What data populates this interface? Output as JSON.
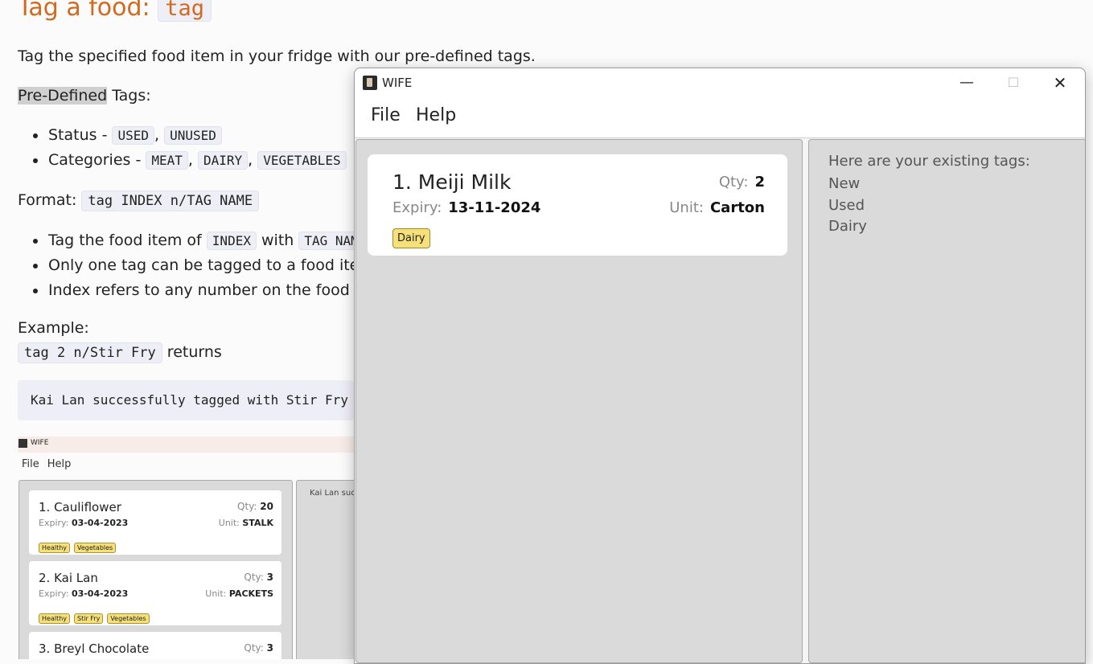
{
  "doc": {
    "title": "Tag a food: ",
    "title_code": "tag",
    "intro": "Tag the specified food item in your fridge with our pre-defined tags.",
    "predefined_highlight": "Pre-Defined",
    "predefined_rest": " Tags:",
    "status_label": "Status - ",
    "status_tags": [
      "USED",
      "UNUSED"
    ],
    "categories_label": "Categories - ",
    "category_tags": [
      "MEAT",
      "DAIRY",
      "VEGETABLES"
    ],
    "format_label": "Format: ",
    "format_code": "tag INDEX n/TAG NAME",
    "bullet1_pre": "Tag the food item of ",
    "bullet1_code1": "INDEX",
    "bullet1_mid": " with ",
    "bullet1_code2": "TAG NAME",
    "bullet2": "Only one tag can be tagged to a food item",
    "bullet3": "Index refers to any number on the food item",
    "example_label": "Example:",
    "example_code": "tag 2 n/Stir Fry",
    "example_rest": " returns",
    "result": "Kai Lan successfully tagged with Stir Fry"
  },
  "mini": {
    "title": "WIFE",
    "menu": [
      "File",
      "Help"
    ],
    "result_text": "Kai Lan successfully tagged with Stir Fry",
    "items": [
      {
        "name": "1.  Cauliflower",
        "qty_label": "Qty:",
        "qty": "20",
        "expiry_label": "Expiry:",
        "expiry": "03-04-2023",
        "unit_label": "Unit:",
        "unit": "STALK",
        "tags": [
          "Healthy",
          "Vegetables"
        ]
      },
      {
        "name": "2.  Kai Lan",
        "qty_label": "Qty:",
        "qty": "3",
        "expiry_label": "Expiry:",
        "expiry": "03-04-2023",
        "unit_label": "Unit:",
        "unit": "PACKETS",
        "tags": [
          "Healthy",
          "Stir Fry",
          "Vegetables"
        ]
      },
      {
        "name": "3.  Breyl Chocolate",
        "qty_label": "Qty:",
        "qty": "3"
      }
    ]
  },
  "window": {
    "title": "WIFE",
    "controls": {
      "minimize": "—",
      "maximize": "☐",
      "close": "✕"
    },
    "menu": [
      "File",
      "Help"
    ],
    "food": {
      "name": "1.  Meiji Milk",
      "qty_label": "Qty:",
      "qty": "2",
      "expiry_label": "Expiry:",
      "expiry": "13-11-2024",
      "unit_label": "Unit:",
      "unit": "Carton",
      "tags": [
        "Dairy"
      ]
    },
    "tags_panel": {
      "heading": "Here are your existing tags:",
      "tags": [
        "New",
        "Used",
        "Dairy"
      ]
    },
    "colors": {
      "tag_bg": "#f5e07a",
      "panel_bg": "#dadada",
      "title_accent": "#d2691e"
    }
  }
}
